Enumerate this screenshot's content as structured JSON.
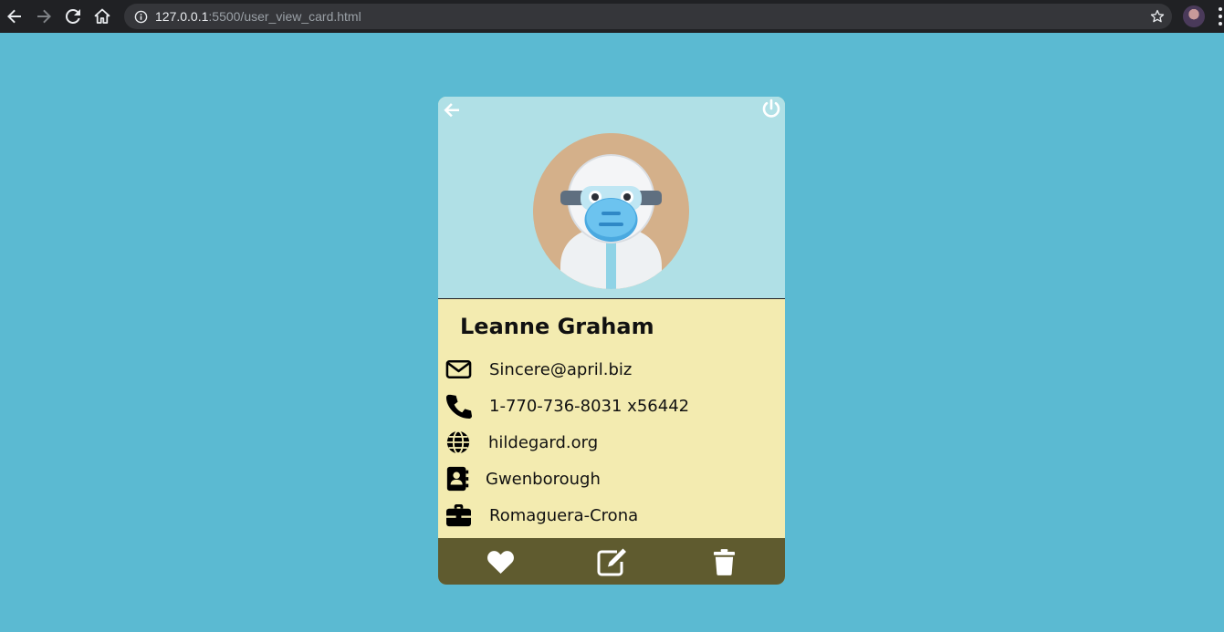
{
  "browser": {
    "url_host": "127.0.0.1",
    "url_path": ":5500/user_view_card.html",
    "back_icon": "arrow-left-icon",
    "forward_icon": "arrow-right-icon",
    "reload_icon": "reload-icon",
    "home_icon": "home-icon",
    "info_icon": "info-icon",
    "bookmark_icon": "star-icon"
  },
  "card": {
    "header": {
      "back_icon": "arrow-left-icon",
      "logout_icon": "power-icon",
      "avatar": "avatar-illustration"
    },
    "name": "Leanne Graham",
    "email": "Sincere@april.biz",
    "phone": "1-770-736-8031 x56442",
    "website": "hildegard.org",
    "city": "Gwenborough",
    "company": "Romaguera-Crona",
    "actions": {
      "like_icon": "heart-icon",
      "edit_icon": "edit-icon",
      "delete_icon": "trash-icon"
    },
    "colors": {
      "page_bg": "#5bbad2",
      "header_bg": "#b0e0e6",
      "body_bg": "#f3ebb0",
      "footer_bg": "#5f5b2f"
    }
  }
}
